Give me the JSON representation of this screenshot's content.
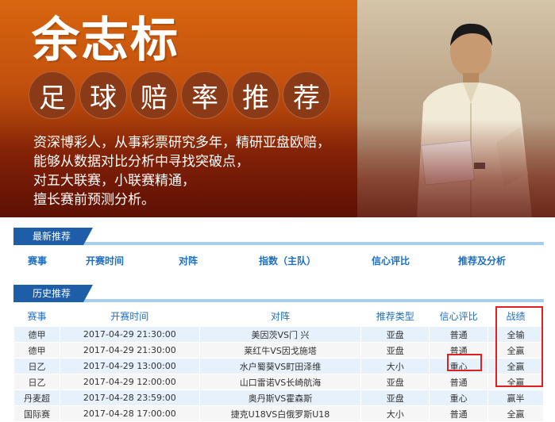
{
  "banner": {
    "name": "余志标",
    "subtitle_chars": [
      "足",
      "球",
      "赔",
      "率",
      "推",
      "荐"
    ],
    "desc_lines": [
      "资深博彩人，从事彩票研究多年，精研亚盘欧赔，",
      "能够从数据对比分析中寻找突破点，",
      "对五大联赛，小联赛精通，",
      "擅长赛前预测分析。"
    ],
    "accent": "#c2500d"
  },
  "latest": {
    "tab": "最新推荐",
    "columns": [
      "赛事",
      "开赛时间",
      "对阵",
      "指数（主队）",
      "信心评比",
      "推荐及分析"
    ]
  },
  "history": {
    "tab": "历史推荐",
    "columns": [
      "赛事",
      "开赛时间",
      "对阵",
      "推荐类型",
      "信心评比",
      "战绩"
    ],
    "rows": [
      {
        "league": "德甲",
        "time": "2017-04-29 21:30:00",
        "match": "美因茨VS门 兴",
        "type": "亚盘",
        "conf": "普通",
        "result": "全输"
      },
      {
        "league": "德甲",
        "time": "2017-04-29 21:30:00",
        "match": "莱红牛VS因戈施塔",
        "type": "亚盘",
        "conf": "普通",
        "result": "全赢"
      },
      {
        "league": "日乙",
        "time": "2017-04-29 13:00:00",
        "match": "水户蜀葵VS町田泽维",
        "type": "大小",
        "conf": "重心",
        "result": "全赢"
      },
      {
        "league": "日乙",
        "time": "2017-04-29 12:00:00",
        "match": "山口雷诺VS长崎航海",
        "type": "亚盘",
        "conf": "普通",
        "result": "全赢"
      },
      {
        "league": "丹麦超",
        "time": "2017-04-28 23:59:00",
        "match": "奥丹斯VS霍森斯",
        "type": "亚盘",
        "conf": "重心",
        "result": "赢半"
      },
      {
        "league": "国际赛",
        "time": "2017-04-28 17:00:00",
        "match": "捷克U18VS白俄罗斯U18",
        "type": "大小",
        "conf": "普通",
        "result": "全赢"
      }
    ],
    "highlight_color": "#e02020"
  }
}
